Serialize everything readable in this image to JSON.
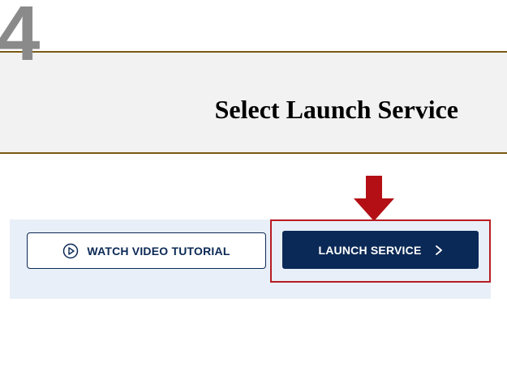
{
  "step": {
    "number": "4",
    "title": "Select Launch Service"
  },
  "buttons": {
    "watch_video": {
      "label": "WATCH VIDEO TUTORIAL",
      "icon": "play-circle-icon"
    },
    "launch_service": {
      "label": "LAUNCH SERVICE",
      "icon": "chevron-right-icon"
    }
  },
  "pointer": {
    "icon": "down-arrow-icon"
  },
  "colors": {
    "navy": "#0b2956",
    "highlight_red": "#b81c22",
    "arrow_red": "#b30f14",
    "rule_gold": "#7a5a14",
    "step_gray": "#8a8a8a",
    "panel_bg": "#e9eff8",
    "band_bg": "#f2f2f2"
  }
}
